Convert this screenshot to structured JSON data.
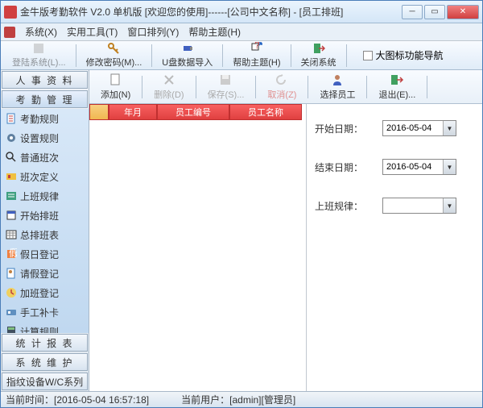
{
  "window": {
    "title": "金牛版考勤软件 V2.0   单机版 [欢迎您的使用]------[公司中文名称] - [员工排班]"
  },
  "menubar": {
    "items": [
      "系统(X)",
      "实用工具(T)",
      "窗口排列(Y)",
      "帮助主题(H)"
    ]
  },
  "toolbar1": {
    "items": [
      {
        "label": "登陆系统(L)...",
        "disabled": true
      },
      {
        "label": "修改密码(M)..."
      },
      {
        "label": "U盘数据导入"
      },
      {
        "label": "帮助主题(H)"
      },
      {
        "label": "关闭系统"
      }
    ],
    "checkbox": "大图标功能导航"
  },
  "sidebar": {
    "top": "人 事 资 料",
    "active": "考 勤 管 理",
    "items": [
      "考勤规则",
      "设置规则",
      "普通班次",
      "班次定义",
      "上班规律",
      "开始排班",
      "总排班表",
      "假日登记",
      "请假登记",
      "加班登记",
      "手工补卡",
      "计算规则"
    ],
    "bottom": [
      "统 计 报 表",
      "系 统 维 护",
      "指纹设备W/C系列"
    ]
  },
  "toolbar2": {
    "items": [
      {
        "label": "添加(N)"
      },
      {
        "label": "删除(D)",
        "dis": true
      },
      {
        "label": "保存(S)...",
        "dis": true
      },
      {
        "label": "取消(Z)",
        "cancel": true,
        "dis": true
      },
      {
        "label": "选择员工"
      },
      {
        "label": "退出(E)..."
      }
    ]
  },
  "grid": {
    "headers": [
      "年月",
      "员工编号",
      "员工名称"
    ]
  },
  "form": {
    "start_label": "开始日期：",
    "end_label": "结束日期：",
    "rule_label": "上班规律：",
    "start_date": "2016-05-04",
    "end_date": "2016-05-04"
  },
  "status": {
    "time_label": "当前时间：",
    "time_value": "[2016-05-04 16:57:18]",
    "user_label": "当前用户：",
    "user_value": "[admin][管理员]"
  }
}
